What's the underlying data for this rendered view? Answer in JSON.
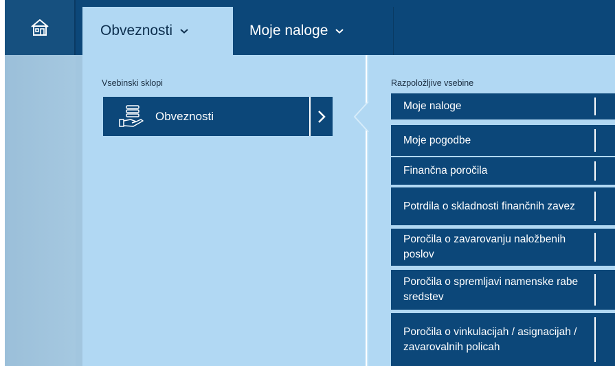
{
  "nav": {
    "home_icon": "home-icon",
    "tabs": [
      {
        "label": "Obveznosti",
        "active": true,
        "icon": "chevron-down-icon"
      },
      {
        "label": "Moje naloge",
        "active": false,
        "icon": "chevron-down-icon"
      }
    ]
  },
  "left": {
    "section_label": "Vsebinski sklopi",
    "group": {
      "label": "Obveznosti",
      "icon": "hand-coins-icon",
      "arrow_icon": "chevron-right-icon"
    }
  },
  "right": {
    "section_label": "Razpoložljive vsebine",
    "items": [
      "Moje naloge",
      "Moje pogodbe",
      "Finančna poročila",
      "Potrdila o skladnosti finančnih zavez",
      "Poročila o zavarovanju naložbenih poslov",
      "Poročila o spremljavi namenske rabe sredstev",
      "Poročila o vinkulacijah / asignacijah / zavarovalnih policah"
    ]
  },
  "colors": {
    "nav_bg": "#0c4779",
    "panel_bg": "#b1d8f3",
    "tile_bg": "#0c4779"
  }
}
